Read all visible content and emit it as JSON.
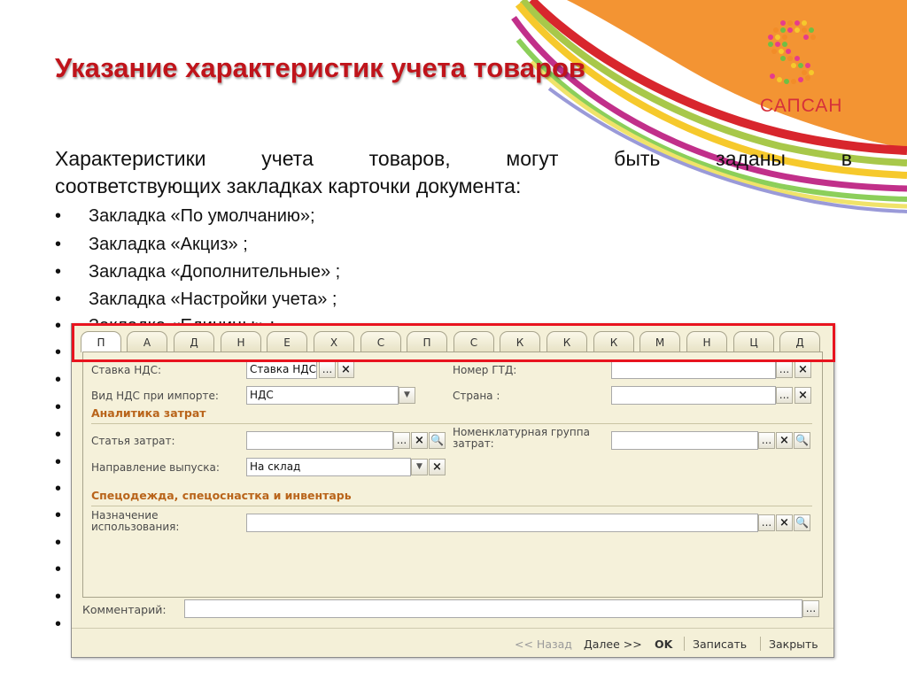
{
  "slide": {
    "title": "Указание характеристик учета товаров",
    "intro_words": [
      "Характеристики",
      "учета",
      "товаров,",
      "могут",
      "быть",
      "заданы",
      "в"
    ],
    "intro_line2": "соответствующих закладках карточки документа:",
    "bullet_char": "•",
    "bullets": [
      "Закладка «По умолчанию»;",
      "Закладка «Акциз» ;",
      "Закладка «Дополнительные» ;",
      "Закладка «Настройки учета» ;",
      "Закладка «Единицы» ;"
    ],
    "logo_text": "САПСАН"
  },
  "form": {
    "tabs": [
      "П",
      "А",
      "Д",
      "Н",
      "Е",
      "Х",
      "С",
      "П",
      "С",
      "К",
      "К",
      "К",
      "М",
      "Н",
      "Ц",
      "Д"
    ],
    "fields": {
      "vat_rate_label": "Ставка НДС:",
      "vat_rate_value": "Ставка НДС",
      "gtd_label": "Номер ГТД:",
      "gtd_value": "",
      "import_vat_label": "Вид НДС при импорте:",
      "import_vat_value": "НДС",
      "country_label": "Страна :",
      "country_value": "",
      "cost_analytics_header": "Аналитика затрат",
      "cost_item_label": "Статья затрат:",
      "cost_item_value": "",
      "nomenclature_group_label": "Номенклатурная группа затрат:",
      "nomenclature_group_value": "",
      "output_direction_label": "Направление выпуска:",
      "output_direction_value": "На склад",
      "workwear_header": "Спецодежда, спецоснастка и инвентарь",
      "purpose_label": "Назначение использования:",
      "purpose_value": "",
      "comment_label": "Комментарий:",
      "comment_value": ""
    },
    "buttons": {
      "ellipsis": "...",
      "clear": "×",
      "dropdown": "▼",
      "search": "🔍"
    },
    "footer": {
      "back": "<< Назад",
      "next": "Далее >>",
      "ok": "OK",
      "save": "Записать",
      "close": "Закрыть"
    }
  },
  "colors": {
    "title": "#c0141b",
    "highlight": "#e8141f",
    "section_header": "#b9641a",
    "form_bg": "#f4f0d8",
    "orange_corner": "#f39433"
  },
  "icons": [
    "logo-dots-icon"
  ]
}
